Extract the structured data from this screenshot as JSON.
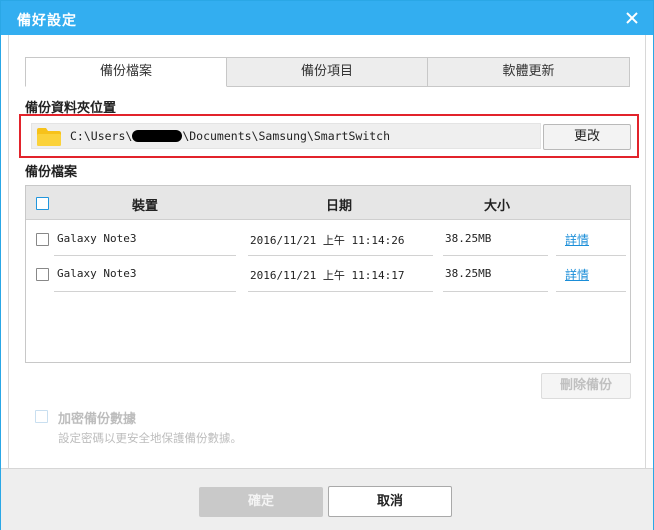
{
  "window": {
    "title": "備好設定"
  },
  "tabs": [
    {
      "label": "備份檔案",
      "active": true
    },
    {
      "label": "備份項目",
      "active": false
    },
    {
      "label": "軟體更新",
      "active": false
    }
  ],
  "folder": {
    "section_label": "備份資料夾位置",
    "path_prefix": "C:\\Users\\",
    "path_suffix": "\\Documents\\Samsung\\SmartSwitch",
    "change_label": "更改"
  },
  "files": {
    "section_label": "備份檔案",
    "columns": {
      "device": "裝置",
      "date": "日期",
      "size": "大小"
    },
    "rows": [
      {
        "device": "Galaxy Note3",
        "date": "2016/11/21 上午 11:14:26",
        "size": "38.25MB",
        "details": "詳情"
      },
      {
        "device": "Galaxy Note3",
        "date": "2016/11/21 上午 11:14:17",
        "size": "38.25MB",
        "details": "詳情"
      }
    ],
    "delete_label": "刪除備份"
  },
  "encrypt": {
    "label": "加密備份數據",
    "description": "設定密碼以更安全地保護備份數據。"
  },
  "footer": {
    "ok_label": "確定",
    "cancel_label": "取消"
  },
  "colors": {
    "titlebar": "#33aef0",
    "highlight_border": "#e2232b",
    "link": "#1b8ed8",
    "folder": "#f7c21a"
  }
}
